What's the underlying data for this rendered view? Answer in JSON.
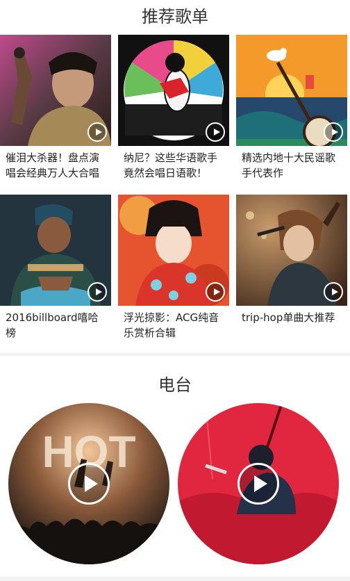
{
  "playlists": {
    "title": "推荐歌单",
    "items": [
      {
        "caption": "催泪大杀器！盘点演唱会经典万人大合唱"
      },
      {
        "caption": "纳尼？这些华语歌手竟然会唱日语歌！"
      },
      {
        "caption": "精选内地十大民谣歌手代表作"
      },
      {
        "caption": "2016billboard嘻哈榜"
      },
      {
        "caption": "浮光掠影：ACG纯音乐赏析合辑"
      },
      {
        "caption": "trip-hop单曲大推荐"
      }
    ]
  },
  "radio": {
    "title": "电台",
    "items": [
      {
        "label": "HOT"
      },
      {
        "label": ""
      }
    ]
  },
  "colors": {
    "page_bg": "#f2f2f2",
    "card_bg": "#ffffff",
    "title_text": "#333333",
    "caption_text": "#222222"
  }
}
